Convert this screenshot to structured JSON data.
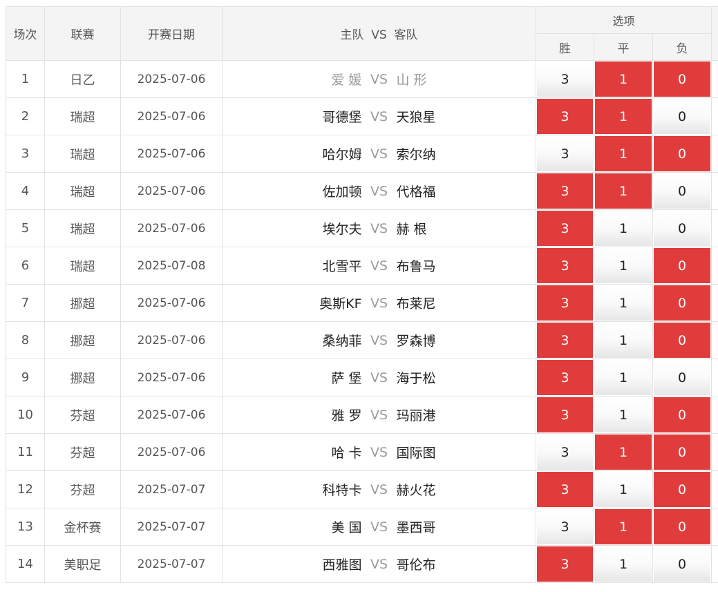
{
  "header": {
    "index": "场次",
    "league": "联赛",
    "date": "开赛日期",
    "match": "主队  VS  客队",
    "options": "选项",
    "win": "胜",
    "draw": "平",
    "lose": "负"
  },
  "colors": {
    "selected": "#e03c3c",
    "header_bg": "#f4f4f4"
  },
  "rows": [
    {
      "index": "1",
      "league": "日乙",
      "date": "2025-07-06",
      "home": "爱 媛",
      "vs": "VS",
      "away": "山 形",
      "dim": true,
      "win": "3",
      "draw": "1",
      "lose": "0",
      "win_sel": false,
      "draw_sel": true,
      "lose_sel": true
    },
    {
      "index": "2",
      "league": "瑞超",
      "date": "2025-07-06",
      "home": "哥德堡",
      "vs": "VS",
      "away": "天狼星",
      "dim": false,
      "win": "3",
      "draw": "1",
      "lose": "0",
      "win_sel": true,
      "draw_sel": true,
      "lose_sel": false
    },
    {
      "index": "3",
      "league": "瑞超",
      "date": "2025-07-06",
      "home": "哈尔姆",
      "vs": "VS",
      "away": "索尔纳",
      "dim": false,
      "win": "3",
      "draw": "1",
      "lose": "0",
      "win_sel": false,
      "draw_sel": true,
      "lose_sel": true
    },
    {
      "index": "4",
      "league": "瑞超",
      "date": "2025-07-06",
      "home": "佐加顿",
      "vs": "VS",
      "away": "代格福",
      "dim": false,
      "win": "3",
      "draw": "1",
      "lose": "0",
      "win_sel": true,
      "draw_sel": true,
      "lose_sel": false
    },
    {
      "index": "5",
      "league": "瑞超",
      "date": "2025-07-06",
      "home": "埃尔夫",
      "vs": "VS",
      "away": "赫 根",
      "dim": false,
      "win": "3",
      "draw": "1",
      "lose": "0",
      "win_sel": true,
      "draw_sel": false,
      "lose_sel": false
    },
    {
      "index": "6",
      "league": "瑞超",
      "date": "2025-07-08",
      "home": "北雪平",
      "vs": "VS",
      "away": "布鲁马",
      "dim": false,
      "win": "3",
      "draw": "1",
      "lose": "0",
      "win_sel": true,
      "draw_sel": false,
      "lose_sel": true
    },
    {
      "index": "7",
      "league": "挪超",
      "date": "2025-07-06",
      "home": "奥斯KF",
      "vs": "VS",
      "away": "布莱尼",
      "dim": false,
      "win": "3",
      "draw": "1",
      "lose": "0",
      "win_sel": true,
      "draw_sel": false,
      "lose_sel": true
    },
    {
      "index": "8",
      "league": "挪超",
      "date": "2025-07-06",
      "home": "桑纳菲",
      "vs": "VS",
      "away": "罗森博",
      "dim": false,
      "win": "3",
      "draw": "1",
      "lose": "0",
      "win_sel": true,
      "draw_sel": false,
      "lose_sel": true
    },
    {
      "index": "9",
      "league": "挪超",
      "date": "2025-07-06",
      "home": "萨 堡",
      "vs": "VS",
      "away": "海于松",
      "dim": false,
      "win": "3",
      "draw": "1",
      "lose": "0",
      "win_sel": true,
      "draw_sel": false,
      "lose_sel": false
    },
    {
      "index": "10",
      "league": "芬超",
      "date": "2025-07-06",
      "home": "雅 罗",
      "vs": "VS",
      "away": "玛丽港",
      "dim": false,
      "win": "3",
      "draw": "1",
      "lose": "0",
      "win_sel": true,
      "draw_sel": false,
      "lose_sel": true
    },
    {
      "index": "11",
      "league": "芬超",
      "date": "2025-07-06",
      "home": "哈 卡",
      "vs": "VS",
      "away": "国际图",
      "dim": false,
      "win": "3",
      "draw": "1",
      "lose": "0",
      "win_sel": false,
      "draw_sel": true,
      "lose_sel": true
    },
    {
      "index": "12",
      "league": "芬超",
      "date": "2025-07-07",
      "home": "科特卡",
      "vs": "VS",
      "away": "赫火花",
      "dim": false,
      "win": "3",
      "draw": "1",
      "lose": "0",
      "win_sel": true,
      "draw_sel": false,
      "lose_sel": true
    },
    {
      "index": "13",
      "league": "金杯赛",
      "date": "2025-07-07",
      "home": "美 国",
      "vs": "VS",
      "away": "墨西哥",
      "dim": false,
      "win": "3",
      "draw": "1",
      "lose": "0",
      "win_sel": false,
      "draw_sel": true,
      "lose_sel": true
    },
    {
      "index": "14",
      "league": "美职足",
      "date": "2025-07-07",
      "home": "西雅图",
      "vs": "VS",
      "away": "哥伦布",
      "dim": false,
      "win": "3",
      "draw": "1",
      "lose": "0",
      "win_sel": true,
      "draw_sel": false,
      "lose_sel": false
    }
  ]
}
